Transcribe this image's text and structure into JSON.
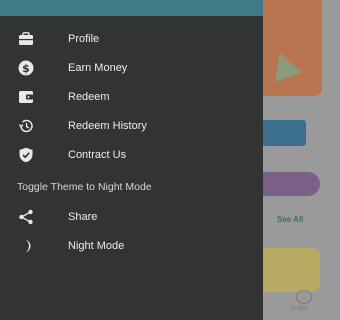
{
  "background": {
    "see_all_label": "See All",
    "nav_label": "Profile"
  },
  "drawer": {
    "items": [
      {
        "label": "Profile",
        "icon": "briefcase-icon"
      },
      {
        "label": "Earn Money",
        "icon": "dollar-icon"
      },
      {
        "label": "Redeem",
        "icon": "wallet-icon"
      },
      {
        "label": "Redeem History",
        "icon": "history-icon"
      },
      {
        "label": "Contract Us",
        "icon": "verified-shield-icon"
      }
    ],
    "section_title": "Toggle Theme to Night Mode",
    "section_items": [
      {
        "label": "Share",
        "icon": "share-icon"
      },
      {
        "label": "Night Mode",
        "icon": "moon-icon"
      }
    ]
  },
  "colors": {
    "drawer_bg": "#323433",
    "header_accent": "#3f7b86",
    "text": "#ececec"
  }
}
